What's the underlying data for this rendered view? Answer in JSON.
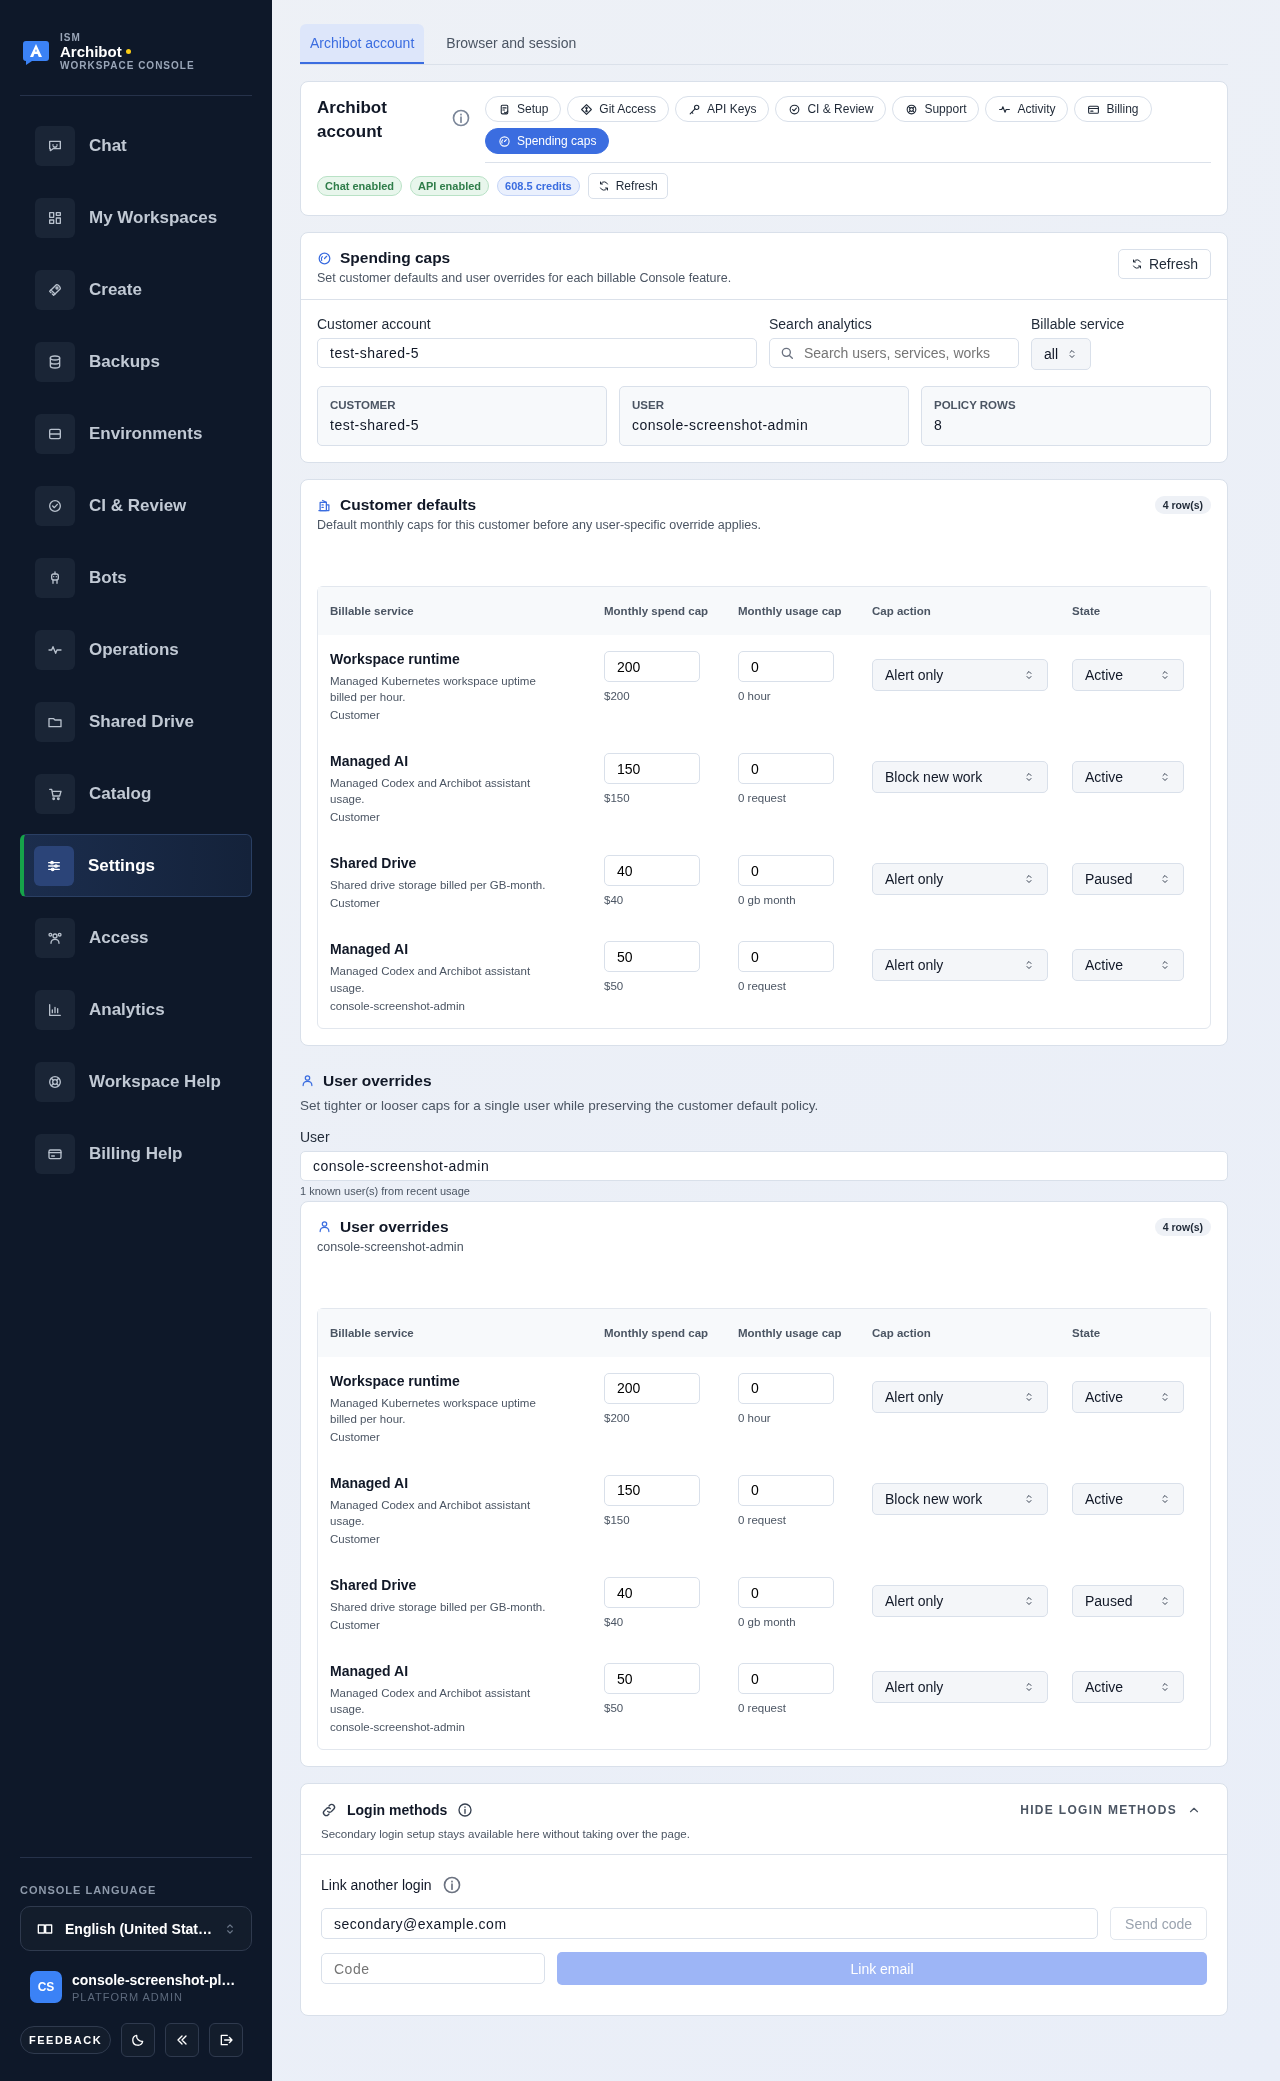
{
  "brand": {
    "org": "ISM",
    "name": "Archibot",
    "subtitle": "WORKSPACE CONSOLE"
  },
  "nav": [
    {
      "label": "Chat",
      "selected": false
    },
    {
      "label": "My Workspaces",
      "selected": false
    },
    {
      "label": "Create",
      "selected": false
    },
    {
      "label": "Backups",
      "selected": false
    },
    {
      "label": "Environments",
      "selected": false
    },
    {
      "label": "CI & Review",
      "selected": false
    },
    {
      "label": "Bots",
      "selected": false
    },
    {
      "label": "Operations",
      "selected": false
    },
    {
      "label": "Shared Drive",
      "selected": false
    },
    {
      "label": "Catalog",
      "selected": false
    },
    {
      "label": "Settings",
      "selected": true
    },
    {
      "label": "Access",
      "selected": false
    },
    {
      "label": "Analytics",
      "selected": false
    },
    {
      "label": "Workspace Help",
      "selected": false
    },
    {
      "label": "Billing Help",
      "selected": false
    }
  ],
  "language": {
    "label": "CONSOLE LANGUAGE",
    "value": "English (United Stat…"
  },
  "user": {
    "initials": "CS",
    "name": "console-screenshot-pl…",
    "role": "PLATFORM ADMIN"
  },
  "footer_buttons": {
    "feedback": "FEEDBACK"
  },
  "tabs": [
    {
      "label": "Archibot account",
      "selected": true
    },
    {
      "label": "Browser and session",
      "selected": false
    }
  ],
  "account": {
    "title": "Archibot account",
    "sections": [
      {
        "label": "Setup",
        "selected": false
      },
      {
        "label": "Git Access",
        "selected": false
      },
      {
        "label": "API Keys",
        "selected": false
      },
      {
        "label": "CI & Review",
        "selected": false
      },
      {
        "label": "Support",
        "selected": false
      },
      {
        "label": "Activity",
        "selected": false
      },
      {
        "label": "Billing",
        "selected": false
      },
      {
        "label": "Spending caps",
        "selected": true
      }
    ],
    "badges": [
      {
        "label": "Chat enabled",
        "kind": "success"
      },
      {
        "label": "API enabled",
        "kind": "success"
      },
      {
        "label": "608.5 credits",
        "kind": "info"
      }
    ],
    "refresh": "Refresh"
  },
  "spending_caps": {
    "title": "Spending caps",
    "subtitle": "Set customer defaults and user overrides for each billable Console feature.",
    "refresh": "Refresh",
    "customer_account": {
      "label": "Customer account",
      "value": "test-shared-5"
    },
    "search": {
      "label": "Search analytics",
      "placeholder": "Search users, services, works"
    },
    "billable_service": {
      "label": "Billable service",
      "value": "all"
    },
    "stats": [
      {
        "label": "CUSTOMER",
        "value": "test-shared-5"
      },
      {
        "label": "USER",
        "value": "console-screenshot-admin"
      },
      {
        "label": "POLICY ROWS",
        "value": "8"
      }
    ]
  },
  "customer_defaults": {
    "title": "Customer defaults",
    "subtitle": "Default monthly caps for this customer before any user-specific override applies.",
    "count": "4 row(s)",
    "columns": [
      "Billable service",
      "Monthly spend cap",
      "Monthly usage cap",
      "Cap action",
      "State"
    ],
    "rows": [
      {
        "service": "Workspace runtime",
        "description": "Managed Kubernetes workspace uptime billed per hour.",
        "scope": "Customer",
        "spend": "200",
        "spend_display": "$200",
        "usage": "0",
        "usage_display": "0 hour",
        "action": "Alert only",
        "state": "Active"
      },
      {
        "service": "Managed AI",
        "description": "Managed Codex and Archibot assistant usage.",
        "scope": "Customer",
        "spend": "150",
        "spend_display": "$150",
        "usage": "0",
        "usage_display": "0 request",
        "action": "Block new work",
        "state": "Active"
      },
      {
        "service": "Shared Drive",
        "description": "Shared drive storage billed per GB-month.",
        "scope": "Customer",
        "spend": "40",
        "spend_display": "$40",
        "usage": "0",
        "usage_display": "0 gb month",
        "action": "Alert only",
        "state": "Paused"
      },
      {
        "service": "Managed AI",
        "description": "Managed Codex and Archibot assistant usage.",
        "scope": "console-screenshot-admin",
        "spend": "50",
        "spend_display": "$50",
        "usage": "0",
        "usage_display": "0 request",
        "action": "Alert only",
        "state": "Active"
      }
    ]
  },
  "user_overrides_section": {
    "title": "User overrides",
    "subtitle": "Set tighter or looser caps for a single user while preserving the customer default policy.",
    "user_label": "User",
    "user_value": "console-screenshot-admin",
    "hint": "1 known user(s) from recent usage"
  },
  "user_overrides": {
    "title": "User overrides",
    "subtitle": "console-screenshot-admin",
    "count": "4 row(s)",
    "columns": [
      "Billable service",
      "Monthly spend cap",
      "Monthly usage cap",
      "Cap action",
      "State"
    ],
    "rows": [
      {
        "service": "Workspace runtime",
        "description": "Managed Kubernetes workspace uptime billed per hour.",
        "scope": "Customer",
        "spend": "200",
        "spend_display": "$200",
        "usage": "0",
        "usage_display": "0 hour",
        "action": "Alert only",
        "state": "Active"
      },
      {
        "service": "Managed AI",
        "description": "Managed Codex and Archibot assistant usage.",
        "scope": "Customer",
        "spend": "150",
        "spend_display": "$150",
        "usage": "0",
        "usage_display": "0 request",
        "action": "Block new work",
        "state": "Active"
      },
      {
        "service": "Shared Drive",
        "description": "Shared drive storage billed per GB-month.",
        "scope": "Customer",
        "spend": "40",
        "spend_display": "$40",
        "usage": "0",
        "usage_display": "0 gb month",
        "action": "Alert only",
        "state": "Paused"
      },
      {
        "service": "Managed AI",
        "description": "Managed Codex and Archibot assistant usage.",
        "scope": "console-screenshot-admin",
        "spend": "50",
        "spend_display": "$50",
        "usage": "0",
        "usage_display": "0 request",
        "action": "Alert only",
        "state": "Active"
      }
    ]
  },
  "login_methods": {
    "title": "Login methods",
    "subtitle": "Secondary login setup stays available here without taking over the page.",
    "toggle": "HIDE LOGIN METHODS",
    "link_title": "Link another login",
    "email": {
      "value": "secondary@example.com"
    },
    "send_code": {
      "label": "Send code",
      "disabled": true
    },
    "code": {
      "placeholder": "Code"
    },
    "link_email": {
      "label": "Link email",
      "disabled": true
    }
  }
}
